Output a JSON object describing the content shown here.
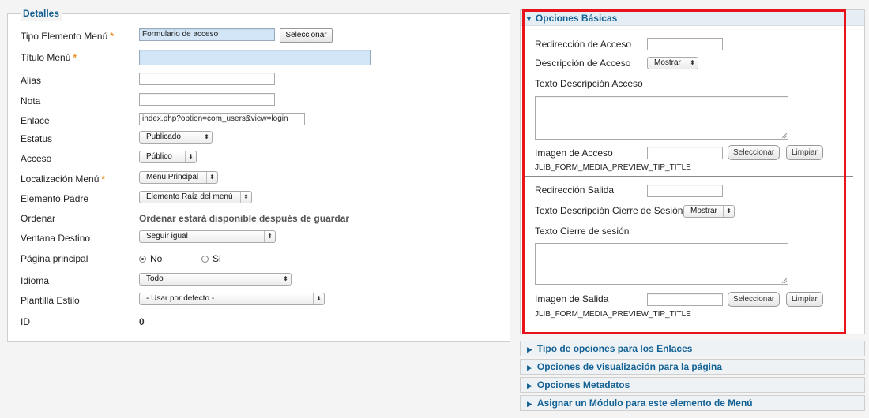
{
  "details": {
    "legend": "Detalles",
    "fields": [
      {
        "label": "Tipo Elemento Menú",
        "value": "Formulario de acceso",
        "button": "Seleccionar"
      },
      {
        "label": "Título Menú",
        "value": ""
      },
      {
        "label": "Alias",
        "value": ""
      },
      {
        "label": "Nota",
        "value": ""
      },
      {
        "label": "Enlace",
        "value": "index.php?option=com_users&view=login"
      },
      {
        "label": "Estatus",
        "value": "Publicado"
      },
      {
        "label": "Acceso",
        "value": "Público"
      },
      {
        "label": "Localización Menú",
        "value": "Menu Principal"
      },
      {
        "label": "Elemento Padre",
        "value": "Elemento Raíz del menú"
      },
      {
        "label": "Ordenar",
        "value": "Ordenar estará disponible después de guardar"
      },
      {
        "label": "Ventana Destino",
        "value": "Seguir igual"
      },
      {
        "label": "Página principal",
        "options": [
          "No",
          "Si"
        ]
      },
      {
        "label": "Idioma",
        "value": "Todo"
      },
      {
        "label": "Plantilla Estilo",
        "value": "- Usar por defecto -"
      },
      {
        "label": "ID",
        "value": "0"
      }
    ]
  },
  "basic_options": {
    "title": "Opciones Básicas",
    "login_redirect_label": "Redirección de Acceso",
    "login_redirect_value": "",
    "login_description_label": "Descripción de Acceso",
    "login_description_value": "Mostrar",
    "login_description_text_label": "Texto Descripción Acceso",
    "login_image_label": "Imagen de Acceso",
    "select_button": "Seleccionar",
    "clear_button": "Limpiar",
    "preview_tip": "JLIB_FORM_MEDIA_PREVIEW_TIP_TITLE",
    "logout_redirect_label": "Redirección Salida",
    "logout_description_label": "Texto Descripción Cierre de Sesión",
    "logout_description_value": "Mostrar",
    "logout_text_label": "Texto Cierre de sesión",
    "logout_image_label": "Imagen de Salida"
  },
  "accordion": [
    "Tipo de opciones para los Enlaces",
    "Opciones de visualización para la página",
    "Opciones Metadatos",
    "Asignar un Módulo para este elemento de Menú"
  ],
  "colors": {
    "heading_blue": "#146295",
    "required_star": "#e5922e",
    "highlight_red": "#e8131b"
  }
}
